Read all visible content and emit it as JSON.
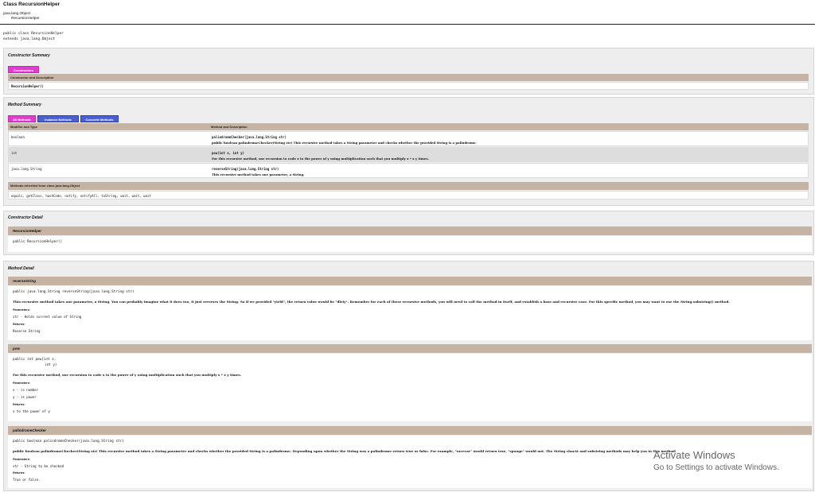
{
  "header": {
    "title": "Class RecursionHelper",
    "inheritance_root": "java.lang.Object",
    "inheritance_child": "RecursionHelper",
    "declaration_line1": "public class RecursionHelper",
    "declaration_line2": "extends java.lang.Object"
  },
  "constructor_summary": {
    "heading": "Constructor Summary",
    "tab_label": "Constructors",
    "column_header": "Constructor and Description",
    "rows": [
      {
        "signature": "RecursionHelper()"
      }
    ]
  },
  "method_summary": {
    "heading": "Method Summary",
    "tabs": [
      "All Methods",
      "Instance Methods",
      "Concrete Methods"
    ],
    "column_headers": [
      "Modifier and Type",
      "Method and Description"
    ],
    "rows": [
      {
        "type": "boolean",
        "signature": "palindromeChecker(java.lang.String str)",
        "description": "public boolean palindromeChecker(String str) This recursive method takes a String parameter and checks whether the provided String is a palindrome."
      },
      {
        "type": "int",
        "signature": "pow(int x, int y)",
        "description": "For this recursive method, use recursion to code x to the power of y using multiplication such that you multiply x * x y times."
      },
      {
        "type": "java.lang.String",
        "signature": "reverseString(java.lang.String str)",
        "description": "This recursive method takes one parameter, a String."
      }
    ],
    "inherited_header": "Methods inherited from class java.lang.Object",
    "inherited_methods": "equals, getClass, hashCode, notify, notifyAll, toString, wait, wait, wait"
  },
  "constructor_detail": {
    "heading": "Constructor Detail",
    "item_name": "RecursionHelper",
    "signature": "public RecursionHelper()"
  },
  "method_detail": {
    "heading": "Method Detail",
    "items": [
      {
        "name": "reverseString",
        "signature": "public java.lang.String reverseString(java.lang.String str)",
        "description": "This recursive method takes one parameter, a String. You can probably imagine what it does too, it just reverses the String. So if we provided \"yield\", the return value would be \"dleiy\". Remember for each of these recursive methods, you will need to call the method in itself, and establish a base and recursive case. For this specific method, you may want to use the String.substring() method.",
        "params_label": "Parameters:",
        "params": [
          "str - Holds current value of String"
        ],
        "returns_label": "Returns:",
        "returns": "Reverse String"
      },
      {
        "name": "pow",
        "signature_line1": "public int pow(int x,",
        "signature_line2": "int y)",
        "description": "For this recursive method, use recursion to code x to the power of y using multiplication such that you multiply x * x y times.",
        "params_label": "Parameters:",
        "params": [
          "x - is number",
          "y - is power"
        ],
        "returns_label": "Returns:",
        "returns": "x to the power of y"
      },
      {
        "name": "palindromeChecker",
        "signature": "public boolean palindromeChecker(java.lang.String str)",
        "description": "public boolean palindromeChecker(String str) This recursive method takes a String parameter and checks whether the provided String is a palindrome. Depending upon whether the String was a palindrome return true or false. For example, \"racecar\" would return true, \"sponge\" would not. The String charAt and substring methods may help you in this method!",
        "params_label": "Parameters:",
        "params": [
          "str - String to be checked"
        ],
        "returns_label": "Returns:",
        "returns": "True or false."
      }
    ]
  },
  "watermark": {
    "line1": "Activate Windows",
    "line2": "Go to Settings to activate Windows."
  }
}
